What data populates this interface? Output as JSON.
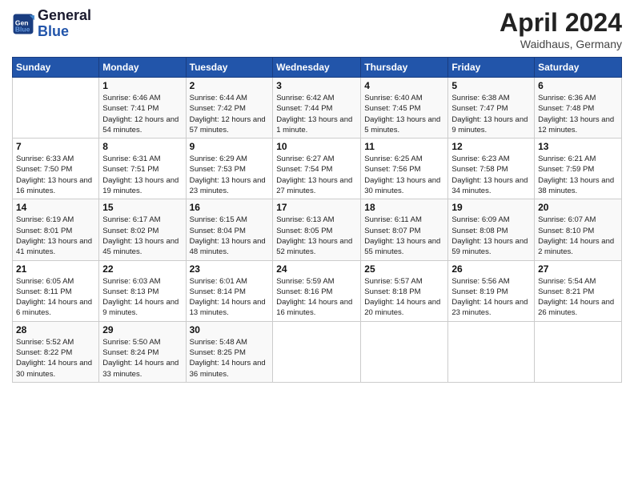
{
  "header": {
    "logo_line1": "General",
    "logo_line2": "Blue",
    "month": "April 2024",
    "location": "Waidhaus, Germany"
  },
  "days_of_week": [
    "Sunday",
    "Monday",
    "Tuesday",
    "Wednesday",
    "Thursday",
    "Friday",
    "Saturday"
  ],
  "weeks": [
    [
      {
        "day": "",
        "sunrise": "",
        "sunset": "",
        "daylight": ""
      },
      {
        "day": "1",
        "sunrise": "Sunrise: 6:46 AM",
        "sunset": "Sunset: 7:41 PM",
        "daylight": "Daylight: 12 hours and 54 minutes."
      },
      {
        "day": "2",
        "sunrise": "Sunrise: 6:44 AM",
        "sunset": "Sunset: 7:42 PM",
        "daylight": "Daylight: 12 hours and 57 minutes."
      },
      {
        "day": "3",
        "sunrise": "Sunrise: 6:42 AM",
        "sunset": "Sunset: 7:44 PM",
        "daylight": "Daylight: 13 hours and 1 minute."
      },
      {
        "day": "4",
        "sunrise": "Sunrise: 6:40 AM",
        "sunset": "Sunset: 7:45 PM",
        "daylight": "Daylight: 13 hours and 5 minutes."
      },
      {
        "day": "5",
        "sunrise": "Sunrise: 6:38 AM",
        "sunset": "Sunset: 7:47 PM",
        "daylight": "Daylight: 13 hours and 9 minutes."
      },
      {
        "day": "6",
        "sunrise": "Sunrise: 6:36 AM",
        "sunset": "Sunset: 7:48 PM",
        "daylight": "Daylight: 13 hours and 12 minutes."
      }
    ],
    [
      {
        "day": "7",
        "sunrise": "Sunrise: 6:33 AM",
        "sunset": "Sunset: 7:50 PM",
        "daylight": "Daylight: 13 hours and 16 minutes."
      },
      {
        "day": "8",
        "sunrise": "Sunrise: 6:31 AM",
        "sunset": "Sunset: 7:51 PM",
        "daylight": "Daylight: 13 hours and 19 minutes."
      },
      {
        "day": "9",
        "sunrise": "Sunrise: 6:29 AM",
        "sunset": "Sunset: 7:53 PM",
        "daylight": "Daylight: 13 hours and 23 minutes."
      },
      {
        "day": "10",
        "sunrise": "Sunrise: 6:27 AM",
        "sunset": "Sunset: 7:54 PM",
        "daylight": "Daylight: 13 hours and 27 minutes."
      },
      {
        "day": "11",
        "sunrise": "Sunrise: 6:25 AM",
        "sunset": "Sunset: 7:56 PM",
        "daylight": "Daylight: 13 hours and 30 minutes."
      },
      {
        "day": "12",
        "sunrise": "Sunrise: 6:23 AM",
        "sunset": "Sunset: 7:58 PM",
        "daylight": "Daylight: 13 hours and 34 minutes."
      },
      {
        "day": "13",
        "sunrise": "Sunrise: 6:21 AM",
        "sunset": "Sunset: 7:59 PM",
        "daylight": "Daylight: 13 hours and 38 minutes."
      }
    ],
    [
      {
        "day": "14",
        "sunrise": "Sunrise: 6:19 AM",
        "sunset": "Sunset: 8:01 PM",
        "daylight": "Daylight: 13 hours and 41 minutes."
      },
      {
        "day": "15",
        "sunrise": "Sunrise: 6:17 AM",
        "sunset": "Sunset: 8:02 PM",
        "daylight": "Daylight: 13 hours and 45 minutes."
      },
      {
        "day": "16",
        "sunrise": "Sunrise: 6:15 AM",
        "sunset": "Sunset: 8:04 PM",
        "daylight": "Daylight: 13 hours and 48 minutes."
      },
      {
        "day": "17",
        "sunrise": "Sunrise: 6:13 AM",
        "sunset": "Sunset: 8:05 PM",
        "daylight": "Daylight: 13 hours and 52 minutes."
      },
      {
        "day": "18",
        "sunrise": "Sunrise: 6:11 AM",
        "sunset": "Sunset: 8:07 PM",
        "daylight": "Daylight: 13 hours and 55 minutes."
      },
      {
        "day": "19",
        "sunrise": "Sunrise: 6:09 AM",
        "sunset": "Sunset: 8:08 PM",
        "daylight": "Daylight: 13 hours and 59 minutes."
      },
      {
        "day": "20",
        "sunrise": "Sunrise: 6:07 AM",
        "sunset": "Sunset: 8:10 PM",
        "daylight": "Daylight: 14 hours and 2 minutes."
      }
    ],
    [
      {
        "day": "21",
        "sunrise": "Sunrise: 6:05 AM",
        "sunset": "Sunset: 8:11 PM",
        "daylight": "Daylight: 14 hours and 6 minutes."
      },
      {
        "day": "22",
        "sunrise": "Sunrise: 6:03 AM",
        "sunset": "Sunset: 8:13 PM",
        "daylight": "Daylight: 14 hours and 9 minutes."
      },
      {
        "day": "23",
        "sunrise": "Sunrise: 6:01 AM",
        "sunset": "Sunset: 8:14 PM",
        "daylight": "Daylight: 14 hours and 13 minutes."
      },
      {
        "day": "24",
        "sunrise": "Sunrise: 5:59 AM",
        "sunset": "Sunset: 8:16 PM",
        "daylight": "Daylight: 14 hours and 16 minutes."
      },
      {
        "day": "25",
        "sunrise": "Sunrise: 5:57 AM",
        "sunset": "Sunset: 8:18 PM",
        "daylight": "Daylight: 14 hours and 20 minutes."
      },
      {
        "day": "26",
        "sunrise": "Sunrise: 5:56 AM",
        "sunset": "Sunset: 8:19 PM",
        "daylight": "Daylight: 14 hours and 23 minutes."
      },
      {
        "day": "27",
        "sunrise": "Sunrise: 5:54 AM",
        "sunset": "Sunset: 8:21 PM",
        "daylight": "Daylight: 14 hours and 26 minutes."
      }
    ],
    [
      {
        "day": "28",
        "sunrise": "Sunrise: 5:52 AM",
        "sunset": "Sunset: 8:22 PM",
        "daylight": "Daylight: 14 hours and 30 minutes."
      },
      {
        "day": "29",
        "sunrise": "Sunrise: 5:50 AM",
        "sunset": "Sunset: 8:24 PM",
        "daylight": "Daylight: 14 hours and 33 minutes."
      },
      {
        "day": "30",
        "sunrise": "Sunrise: 5:48 AM",
        "sunset": "Sunset: 8:25 PM",
        "daylight": "Daylight: 14 hours and 36 minutes."
      },
      {
        "day": "",
        "sunrise": "",
        "sunset": "",
        "daylight": ""
      },
      {
        "day": "",
        "sunrise": "",
        "sunset": "",
        "daylight": ""
      },
      {
        "day": "",
        "sunrise": "",
        "sunset": "",
        "daylight": ""
      },
      {
        "day": "",
        "sunrise": "",
        "sunset": "",
        "daylight": ""
      }
    ]
  ]
}
